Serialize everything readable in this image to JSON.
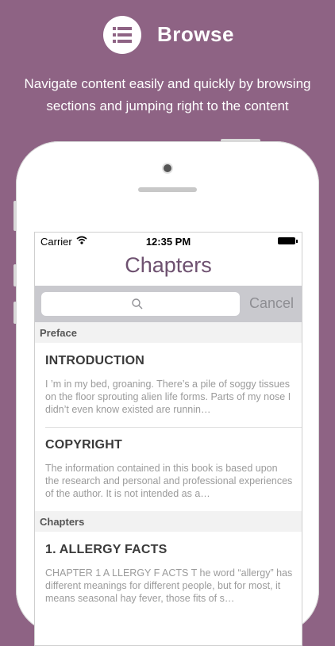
{
  "promo": {
    "title": "Browse",
    "description": "Navigate content easily and quickly by browsing sections and jumping right to the content",
    "logo_icon": "list-icon"
  },
  "status_bar": {
    "carrier": "Carrier",
    "time": "12:35 PM"
  },
  "nav": {
    "title": "Chapters"
  },
  "search": {
    "placeholder": "",
    "cancel_label": "Cancel"
  },
  "sections": [
    {
      "header": "Preface",
      "items": [
        {
          "title": "INTRODUCTION",
          "excerpt": "I ’m in my bed, groaning. There’s a pile of soggy tissues on the floor sprouting alien life forms. Parts of my nose I didn’t even know existed are runnin…"
        },
        {
          "title": "COPYRIGHT",
          "excerpt": "The information contained in this book is based upon the research and personal and professional experiences of the author. It is not intended as a…"
        }
      ]
    },
    {
      "header": "Chapters",
      "items": [
        {
          "title": "1. ALLERGY FACTS",
          "excerpt": "CHAPTER 1 A LLERGY F ACTS T he word “allergy” has different meanings for different people, but for most, it means seasonal hay fever, those fits of s…"
        }
      ]
    }
  ],
  "colors": {
    "background": "#8e6384",
    "accent": "#6e5170"
  }
}
